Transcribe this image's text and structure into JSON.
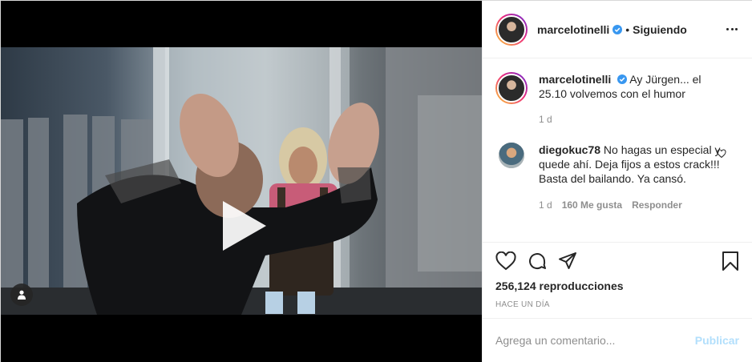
{
  "post": {
    "author": "marcelotinelli",
    "follow_status": "Siguiendo",
    "dot": "•",
    "caption": "Ay Jürgen... el 25.10 volvemos con el humor",
    "caption_age": "1 d",
    "views": "256,124 reproducciones",
    "posted_ago": "HACE UN DÍA"
  },
  "comments": [
    {
      "user": "diegokuc78",
      "text": "No hagas un especial y quede ahí. Deja fijos a estos crack!!! Basta del bailando. Ya cansó.",
      "age": "1 d",
      "likes": "160 Me gusta",
      "reply": "Responder"
    }
  ],
  "add_comment": {
    "placeholder": "Agrega un comentario...",
    "publish": "Publicar"
  },
  "icons": {
    "verified": "verified-badge-icon",
    "more": "more-options-icon",
    "like": "heart-icon",
    "comment": "comment-icon",
    "share": "paper-plane-icon",
    "save": "bookmark-icon",
    "play": "play-icon",
    "tagged": "user-tag-icon"
  },
  "colors": {
    "verified": "#3897f0",
    "publish_disabled": "#b2dffc",
    "muted": "#8e8e8e"
  }
}
